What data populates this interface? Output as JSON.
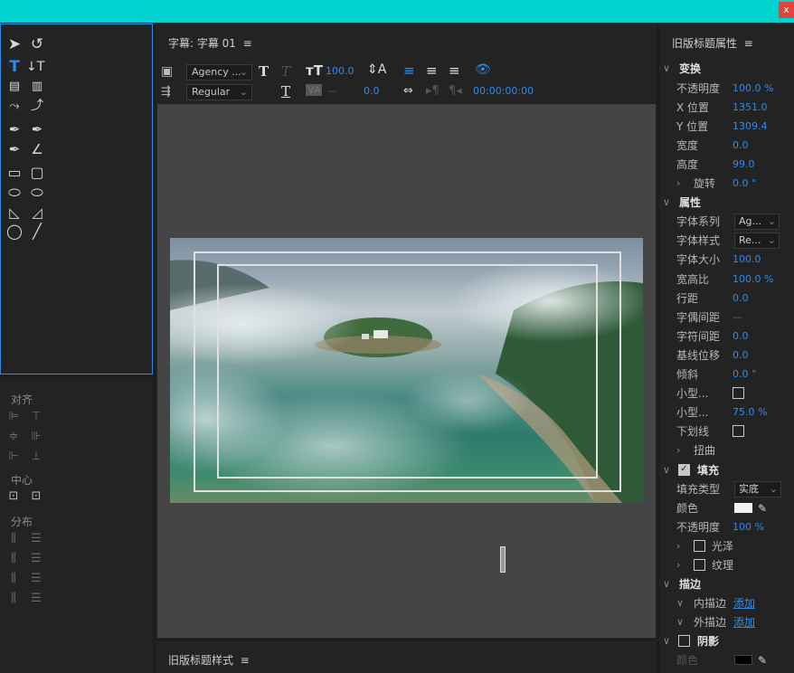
{
  "window": {
    "close_label": "x"
  },
  "center": {
    "title": "字幕: 字幕 01",
    "menu_icon": "≡",
    "font_family": "Agency ...",
    "font_style": "Regular",
    "font_size": "100.0",
    "kerning": "0.0",
    "timecode": "00:00:00:00",
    "dash": "—"
  },
  "bottom": {
    "title": "旧版标题样式",
    "menu_icon": "≡"
  },
  "align": {
    "section_align": "对齐",
    "section_center": "中心",
    "section_distribute": "分布"
  },
  "props": {
    "title": "旧版标题属性",
    "menu_icon": "≡",
    "transform": {
      "header": "变换",
      "opacity_label": "不透明度",
      "opacity": "100.0 %",
      "x_label": "X 位置",
      "x": "1351.0",
      "y_label": "Y 位置",
      "y": "1309.4",
      "width_label": "宽度",
      "width": "0.0",
      "height_label": "高度",
      "height": "99.0",
      "rotation_label": "旋转",
      "rotation": "0.0 °"
    },
    "attributes": {
      "header": "属性",
      "font_family_label": "字体系列",
      "font_family": "Ag...",
      "font_style_label": "字体样式",
      "font_style": "Re...",
      "font_size_label": "字体大小",
      "font_size": "100.0",
      "aspect_label": "宽高比",
      "aspect": "100.0 %",
      "leading_label": "行距",
      "leading": "0.0",
      "kerning_label": "字偶间距",
      "kerning": "—",
      "tracking_label": "字符间距",
      "tracking": "0.0",
      "baseline_label": "基线位移",
      "baseline": "0.0",
      "slant_label": "倾斜",
      "slant": "0.0 °",
      "smallcaps_label": "小型...",
      "smallcaps_size_label": "小型...",
      "smallcaps_size": "75.0 %",
      "underline_label": "下划线",
      "distort_label": "扭曲"
    },
    "fill": {
      "header": "填充",
      "fill_type_label": "填充类型",
      "fill_type": "实底",
      "color_label": "颜色",
      "color": "#f0f0f0",
      "opacity_label": "不透明度",
      "opacity": "100 %",
      "sheen_label": "光泽",
      "texture_label": "纹理"
    },
    "stroke": {
      "header": "描边",
      "inner_label": "内描边",
      "inner_add": "添加",
      "outer_label": "外描边",
      "outer_add": "添加"
    },
    "shadow": {
      "header": "阴影",
      "color_label": "颜色",
      "color": "#000000"
    }
  }
}
